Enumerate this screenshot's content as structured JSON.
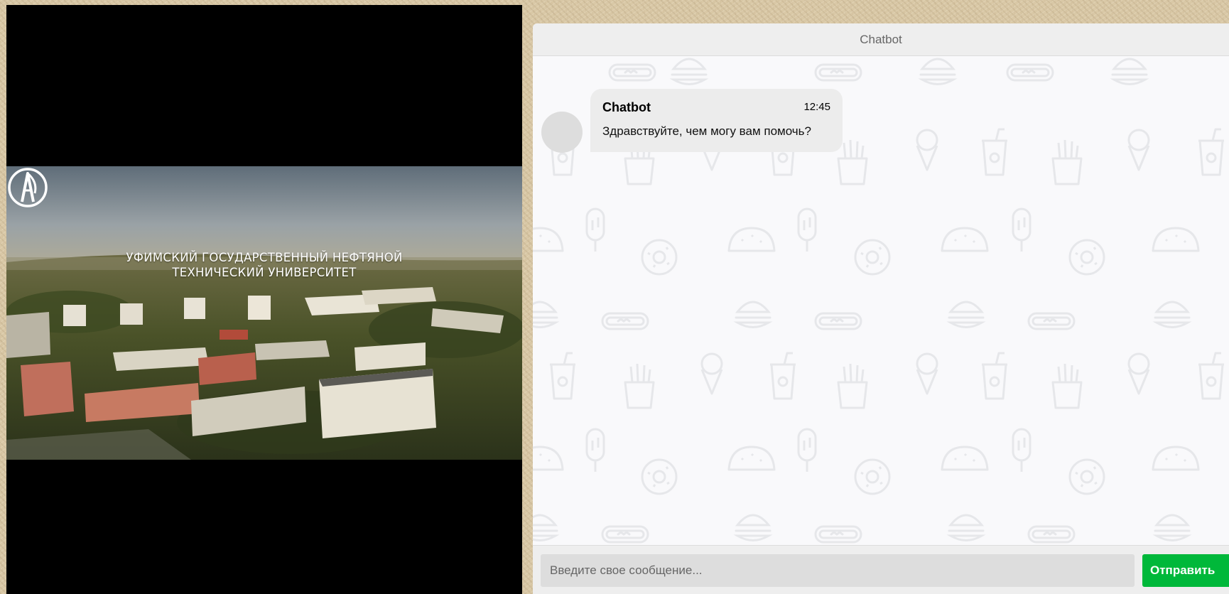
{
  "video": {
    "logo_icon": "university-emblem-icon",
    "title_line1": "УФИМСКИЙ ГОСУДАРСТВЕННЫЙ НЕФТЯНОЙ",
    "title_line2": "ТЕХНИЧЕСКИЙ УНИВЕРСИТЕТ"
  },
  "chat": {
    "header_title": "Chatbot",
    "messages": [
      {
        "sender": "Chatbot",
        "time": "12:45",
        "text": "Здравствуйте, чем могу вам помочь?"
      }
    ],
    "background_icons": [
      "burger-icon",
      "hotdog-icon",
      "fries-icon",
      "icecream-icon",
      "soda-cup-icon",
      "donut-icon",
      "taco-icon",
      "popsicle-icon"
    ],
    "input": {
      "placeholder": "Введите свое сообщение...",
      "value": ""
    },
    "send_label": "Отправить"
  },
  "colors": {
    "send_button": "#00b83a",
    "chat_background": "#f9f9fb",
    "header_background": "#eeeeee",
    "bubble_background": "#ececec"
  }
}
